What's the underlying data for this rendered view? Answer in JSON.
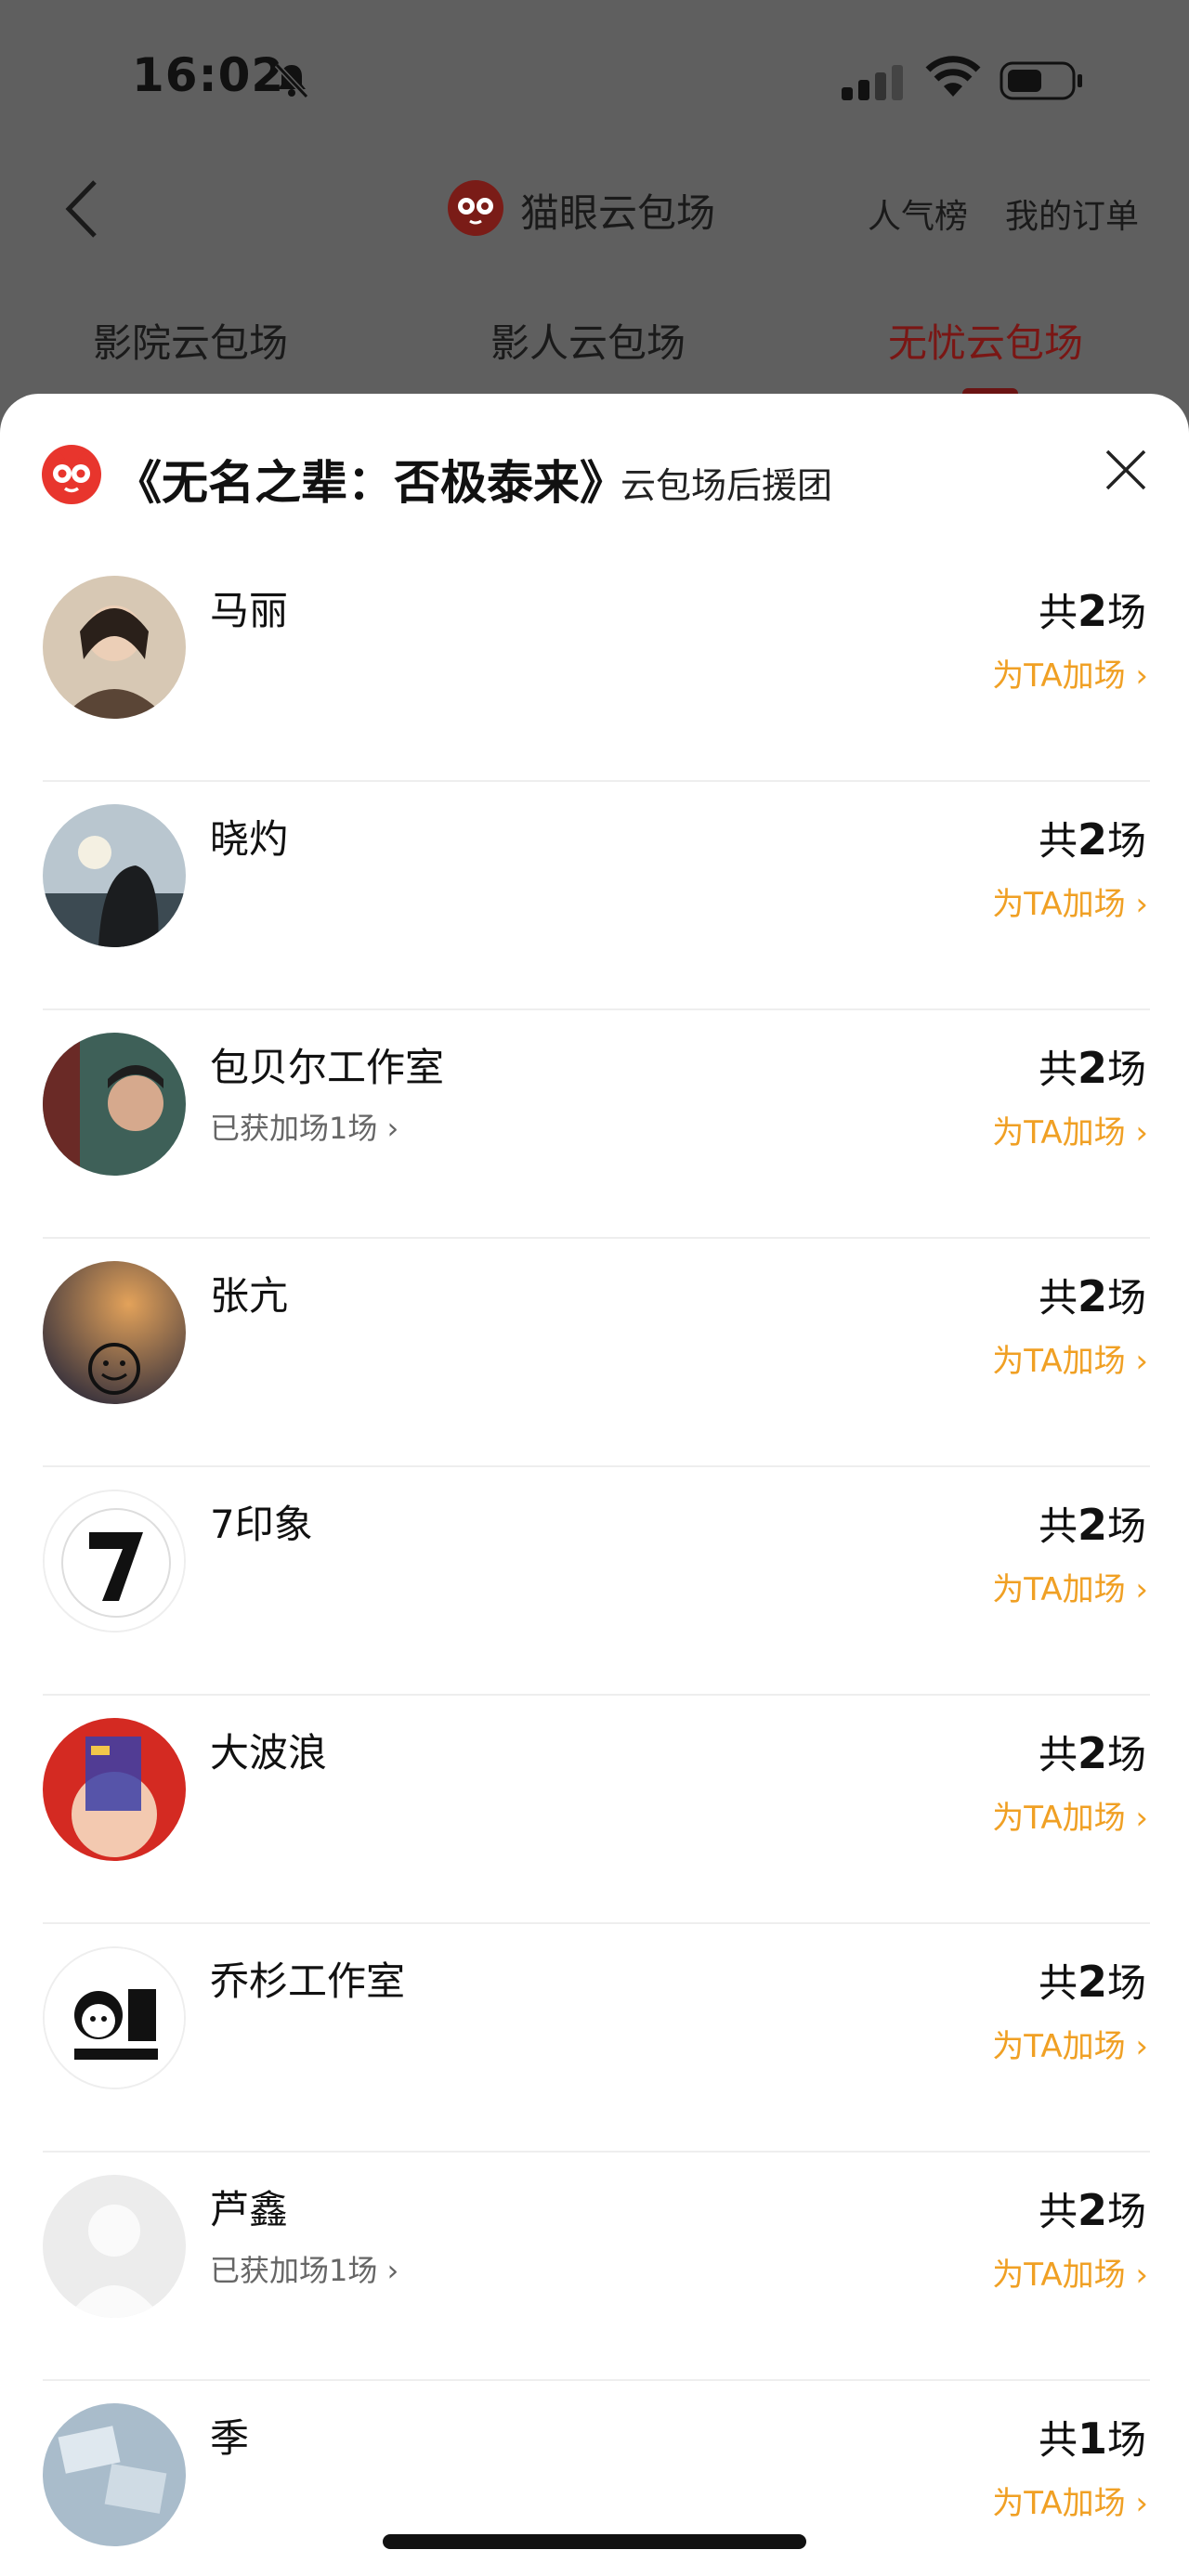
{
  "status_bar": {
    "time": "16:02"
  },
  "nav": {
    "title": "猫眼云包场",
    "rank_link": "人气榜",
    "orders_link": "我的订单"
  },
  "tabs": [
    {
      "label": "影院云包场"
    },
    {
      "label": "影人云包场"
    },
    {
      "label": "无忧云包场",
      "active": true
    }
  ],
  "sheet": {
    "title": "《无名之辈：否极泰来》",
    "subtitle": "云包场后援团",
    "count_prefix": "共",
    "count_suffix": "场",
    "boost_label": "为TA加场",
    "items": [
      {
        "name": "马丽",
        "count": "2",
        "extra": ""
      },
      {
        "name": "晓灼",
        "count": "2",
        "extra": ""
      },
      {
        "name": "包贝尔工作室",
        "count": "2",
        "extra": "已获加场1场"
      },
      {
        "name": "张亢",
        "count": "2",
        "extra": ""
      },
      {
        "name": "7印象",
        "count": "2",
        "extra": ""
      },
      {
        "name": "大波浪",
        "count": "2",
        "extra": ""
      },
      {
        "name": "乔杉工作室",
        "count": "2",
        "extra": ""
      },
      {
        "name": "芦鑫",
        "count": "2",
        "extra": "已获加场1场"
      },
      {
        "name": "季",
        "count": "1",
        "extra": ""
      }
    ]
  },
  "colors": {
    "accent_orange": "#f0a024",
    "brand_red": "#e8352d",
    "active_tab": "#7a1614"
  }
}
